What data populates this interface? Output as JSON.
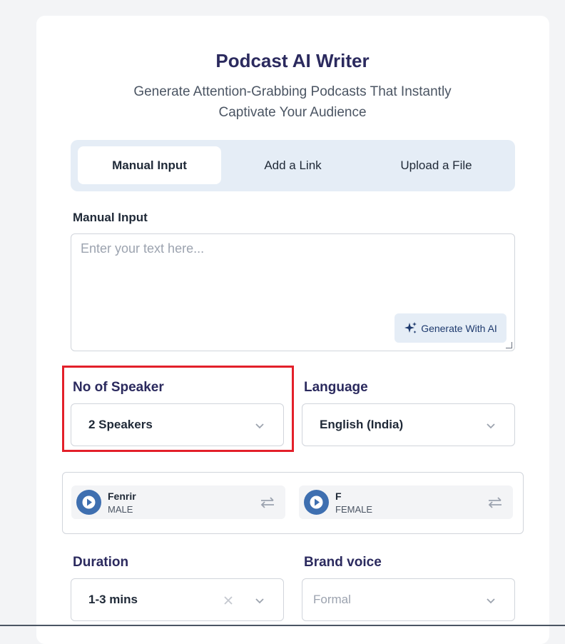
{
  "header": {
    "title": "Podcast AI Writer",
    "subtitle": "Generate Attention-Grabbing Podcasts That Instantly Captivate Your Audience"
  },
  "tabs": [
    {
      "label": "Manual Input",
      "active": true
    },
    {
      "label": "Add a Link",
      "active": false
    },
    {
      "label": "Upload a File",
      "active": false
    }
  ],
  "manual_input": {
    "label": "Manual Input",
    "placeholder": "Enter your text here...",
    "value": "",
    "generate_button": "Generate With AI",
    "generate_icon": "sparkles-icon"
  },
  "speakers": {
    "label": "No of Speaker",
    "value": "2 Speakers"
  },
  "language": {
    "label": "Language",
    "value": "English (India)"
  },
  "voices": [
    {
      "name": "Fenrir",
      "gender": "MALE"
    },
    {
      "name": "F",
      "gender": "FEMALE"
    }
  ],
  "duration": {
    "label": "Duration",
    "value": "1-3 mins"
  },
  "brand_voice": {
    "label": "Brand voice",
    "placeholder": "Formal"
  },
  "colors": {
    "title": "#2b2a5e",
    "accent": "#3e6fb0",
    "highlight": "#e3202a",
    "tab_bg": "#e5edf6"
  }
}
